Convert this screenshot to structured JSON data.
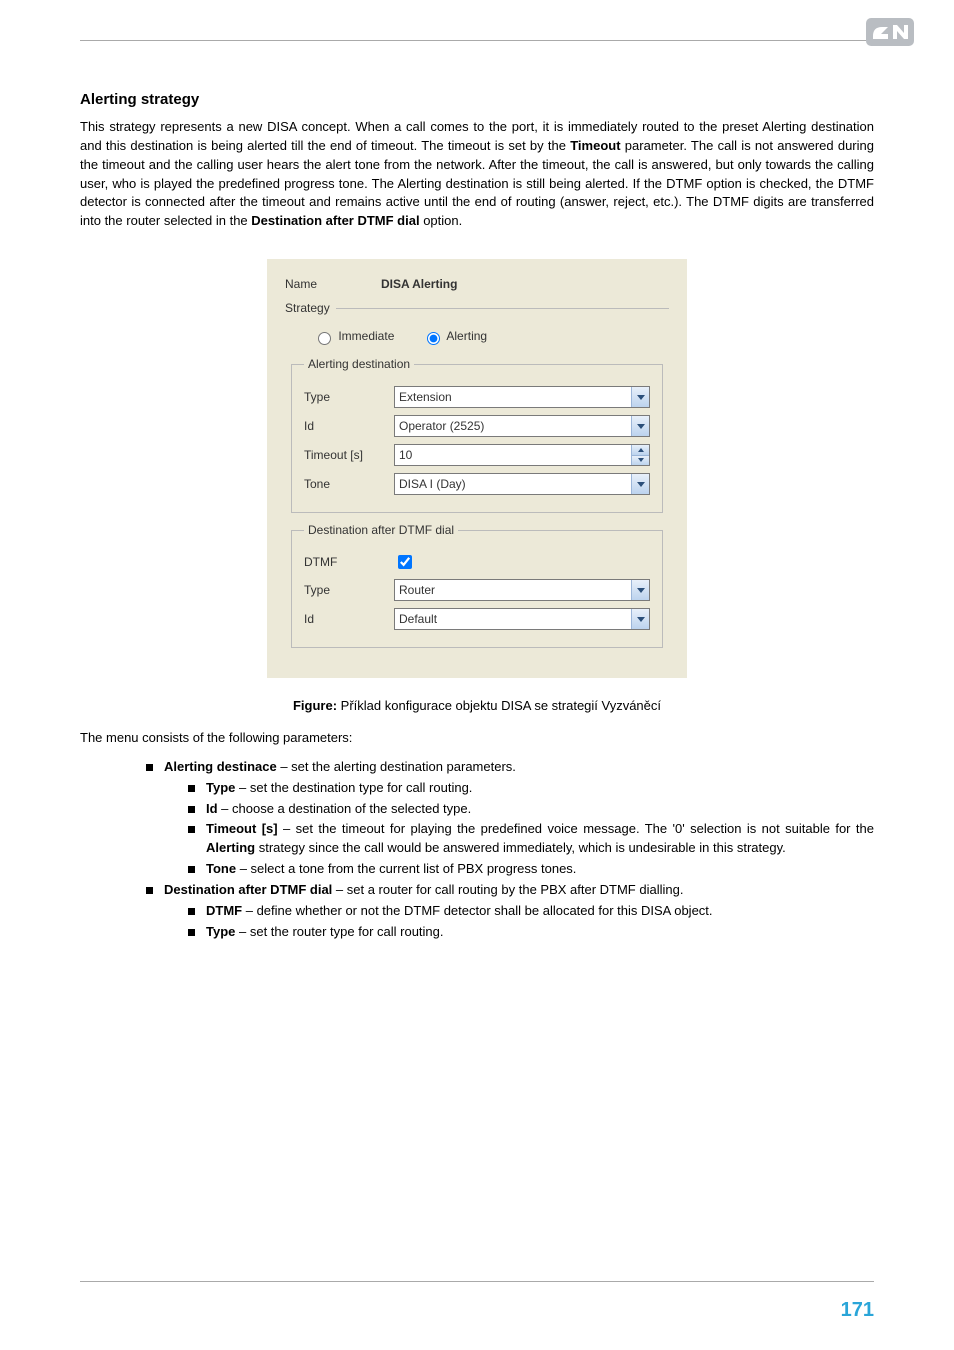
{
  "page_number": "171",
  "section": {
    "title": "Alerting strategy",
    "paragraph": "This strategy represents a new DISA concept. When a call comes to the port, it is immediately routed to the preset Alerting destination and this destination is being alerted till the end of timeout. The timeout is set by the Timeout parameter. The call is not answered during the timeout and the calling user hears the alert tone from the network. After the timeout, the call is answered, but only towards the calling user, who is played the predefined progress tone. The Alerting destination is still being alerted. If the DTMF option is checked, the DTMF detector is connected after the timeout and remains active until the end of routing (answer, reject, etc.). The DTMF digits are transferred into the router selected in the Destination after DTMF dial option.",
    "p_bold": {
      "timeout": "Timeout",
      "dest_after": "Destination after DTMF dial"
    }
  },
  "figure": {
    "name_label": "Name",
    "name_value": "DISA Alerting",
    "strategy_legend": "Strategy",
    "radio_immediate": "Immediate",
    "radio_alerting": "Alerting",
    "alert_dest_legend": "Alerting destination",
    "labels": {
      "type": "Type",
      "id": "Id",
      "timeout": "Timeout [s]",
      "tone": "Tone",
      "dtmf": "DTMF"
    },
    "values": {
      "type1": "Extension",
      "id1": "Operator (2525)",
      "timeout": "10",
      "tone": "DISA I (Day)",
      "type2": "Router",
      "id2": "Default"
    },
    "dest_after_legend": "Destination after DTMF dial",
    "caption_bold": "Figure:",
    "caption_rest": " Příklad konfigurace objektu DISA se strategií Vyzváněcí"
  },
  "params": {
    "intro": "The menu consists of the following parameters:",
    "alerting_dest_b": "Alerting destinace",
    "alerting_dest_t": " – set the alerting destination parameters.",
    "type_b": "Type",
    "type_t": " – set the destination type for call routing.",
    "id_b": "Id",
    "id_t": " – choose a destination of the selected type.",
    "timeout_b": "Timeout [s]",
    "timeout_t1": " – set the timeout for playing the predefined voice message. The '0' selection is not suitable for the ",
    "timeout_bold_inline": "Alerting",
    "timeout_t2": " strategy since the call would be answered immediately, which is undesirable in this strategy.",
    "tone_b": "Tone",
    "tone_t": " – select a tone from the current list of PBX progress tones.",
    "dest_after_b": "Destination after DTMF dial",
    "dest_after_t": " – set a router for call routing by the PBX after DTMF dialling.",
    "dtmf_b": "DTMF",
    "dtmf_t": " – define whether or not the DTMF detector shall be allocated for this DISA object.",
    "type2_b": "Type",
    "type2_t": " – set the router type for call routing."
  }
}
